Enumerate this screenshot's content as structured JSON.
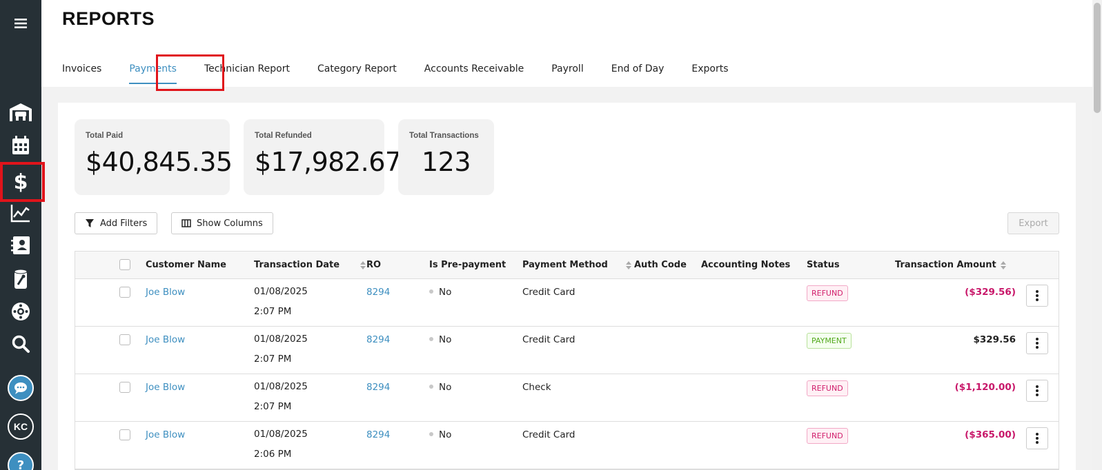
{
  "sidebar": {
    "items": [
      {
        "name": "menu-icon"
      },
      {
        "name": "garage-icon"
      },
      {
        "name": "calendar-icon"
      },
      {
        "name": "dollar-icon",
        "active": true
      },
      {
        "name": "chart-icon"
      },
      {
        "name": "contacts-icon"
      },
      {
        "name": "parts-icon"
      },
      {
        "name": "tire-icon"
      },
      {
        "name": "search-icon"
      },
      {
        "name": "chat-icon"
      }
    ],
    "user_initials": "KC",
    "help_label": "?"
  },
  "page": {
    "title": "REPORTS",
    "tabs": [
      {
        "label": "Invoices"
      },
      {
        "label": "Payments",
        "active": true
      },
      {
        "label": "Technician Report"
      },
      {
        "label": "Category Report"
      },
      {
        "label": "Accounts Receivable"
      },
      {
        "label": "Payroll"
      },
      {
        "label": "End of Day"
      },
      {
        "label": "Exports"
      }
    ]
  },
  "stats": {
    "total_paid": {
      "label": "Total Paid",
      "value": "$40,845.35"
    },
    "total_refunded": {
      "label": "Total Refunded",
      "value": "$17,982.67"
    },
    "total_transactions": {
      "label": "Total Transactions",
      "value": "123"
    }
  },
  "toolbar": {
    "add_filters": "Add Filters",
    "show_columns": "Show Columns",
    "export": "Export"
  },
  "table": {
    "columns": {
      "customer": "Customer Name",
      "date": "Transaction Date",
      "ro": "RO",
      "prepay": "Is Pre-payment",
      "method": "Payment Method",
      "auth": "Auth Code",
      "notes": "Accounting Notes",
      "status": "Status",
      "amount": "Transaction Amount"
    },
    "rows": [
      {
        "customer": "Joe Blow",
        "date": "01/08/2025",
        "time": "2:07 PM",
        "ro": "8294",
        "prepay": "No",
        "method": "Credit Card",
        "status": "REFUND",
        "amount": "($329.56)"
      },
      {
        "customer": "Joe Blow",
        "date": "01/08/2025",
        "time": "2:07 PM",
        "ro": "8294",
        "prepay": "No",
        "method": "Credit Card",
        "status": "PAYMENT",
        "amount": "$329.56"
      },
      {
        "customer": "Joe Blow",
        "date": "01/08/2025",
        "time": "2:07 PM",
        "ro": "8294",
        "prepay": "No",
        "method": "Check",
        "status": "REFUND",
        "amount": "($1,120.00)"
      },
      {
        "customer": "Joe Blow",
        "date": "01/08/2025",
        "time": "2:06 PM",
        "ro": "8294",
        "prepay": "No",
        "method": "Credit Card",
        "status": "REFUND",
        "amount": "($365.00)"
      }
    ]
  },
  "colors": {
    "sidebar_bg": "#263036",
    "accent": "#3e8fc0",
    "highlight": "#e0141b",
    "refund": "#c8186a",
    "payment": "#52a81c"
  }
}
